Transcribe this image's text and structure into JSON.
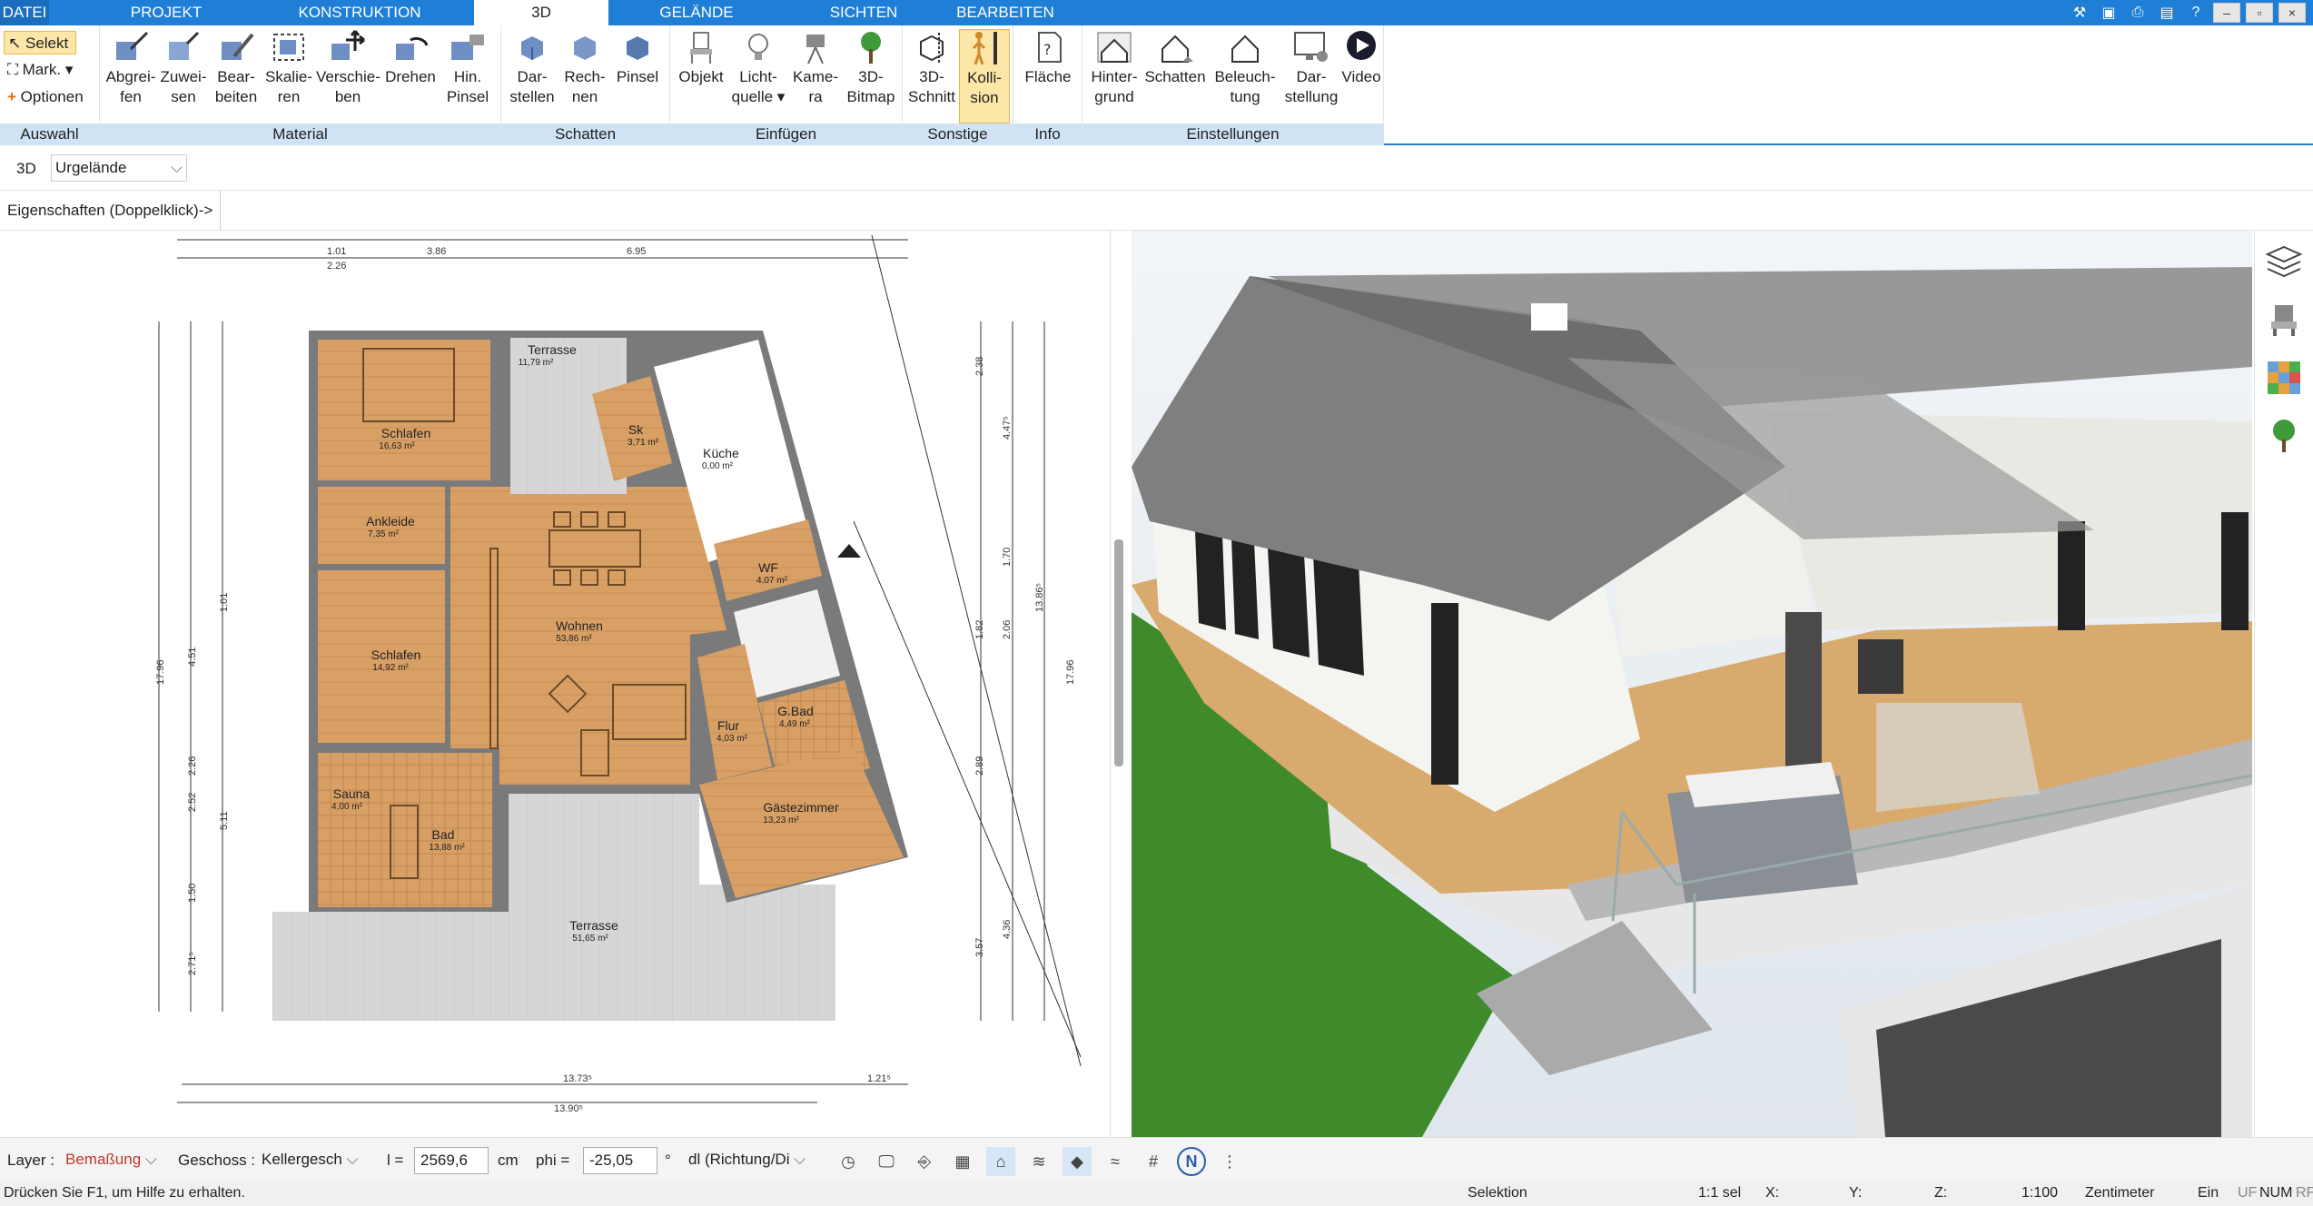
{
  "menu_tabs": [
    "DATEI",
    "PROJEKT",
    "KONSTRUKTION",
    "3D",
    "GELÄNDE",
    "SICHTEN",
    "BEARBEITEN"
  ],
  "active_tab": "3D",
  "ribbon": {
    "auswahl": {
      "selekt": "Selekt",
      "mark": "Mark.",
      "optionen": "Optionen",
      "label": "Auswahl"
    },
    "material": {
      "label": "Material",
      "buttons": [
        [
          "Abgrei-",
          "fen"
        ],
        [
          "Zuwei-",
          "sen"
        ],
        [
          "Bear-",
          "beiten"
        ],
        [
          "Skalie-",
          "ren"
        ],
        [
          "Verschie-",
          "ben"
        ],
        [
          "Drehen",
          ""
        ],
        [
          "Hin.",
          "Pinsel"
        ]
      ]
    },
    "schatten": {
      "label": "Schatten",
      "buttons": [
        [
          "Dar-",
          "stellen"
        ],
        [
          "Rech-",
          "nen"
        ],
        [
          "Pinsel",
          ""
        ]
      ]
    },
    "einfuegen": {
      "label": "Einfügen",
      "buttons": [
        [
          "Objekt",
          ""
        ],
        [
          "Licht-",
          "quelle"
        ],
        [
          "Kame-",
          "ra"
        ],
        [
          "3D-",
          "Bitmap"
        ]
      ]
    },
    "sonstige": {
      "label": "Sonstige",
      "buttons": [
        [
          "3D-",
          "Schnitt"
        ],
        [
          "Kolli-",
          "sion"
        ]
      ]
    },
    "info": {
      "label": "Info",
      "buttons": [
        [
          "Fläche",
          ""
        ]
      ]
    },
    "einstellungen": {
      "label": "Einstellungen",
      "buttons": [
        [
          "Hinter-",
          "grund"
        ],
        [
          "Schatten",
          ""
        ],
        [
          "Beleuch-",
          "tung"
        ],
        [
          "Dar-",
          "stellung"
        ],
        [
          "Video",
          ""
        ]
      ]
    }
  },
  "viewbar": {
    "mode": "3D",
    "terrain": "Urgelände"
  },
  "propbar": {
    "text": "Eigenschaften (Doppelklick)->"
  },
  "plan": {
    "dims_top": [
      "1.01",
      "3.86",
      "6.95",
      "2.26"
    ],
    "dims_bottom": [
      "13.73⁵",
      "13.90⁵",
      "1.21⁵"
    ],
    "dims_left": [
      "17.96",
      "4.51",
      "5.11",
      "1.01",
      "2.26",
      "1.50",
      "2.71⁵",
      "2.52"
    ],
    "dims_right": [
      "17.96",
      "13.86⁵",
      "2.38",
      "4.47⁵",
      "1.70",
      "2.06",
      "2.89",
      "3.57",
      "4.36",
      "1.82"
    ],
    "rooms": [
      {
        "name": "Terrasse",
        "area": "11,79 m²"
      },
      {
        "name": "Schlafen",
        "area": "16,63 m²"
      },
      {
        "name": "Sk",
        "area": "3,71 m²"
      },
      {
        "name": "Küche",
        "area": "0,00 m²"
      },
      {
        "name": "Ankleide",
        "area": "7,35 m²"
      },
      {
        "name": "WF",
        "area": "4,07 m²"
      },
      {
        "name": "Wohnen",
        "area": "53,86 m²"
      },
      {
        "name": "Schlafen",
        "area": "14,92 m²"
      },
      {
        "name": "G.Bad",
        "area": "4,49 m²"
      },
      {
        "name": "Flur",
        "area": "4,03 m²"
      },
      {
        "name": "Sauna",
        "area": "4,00 m²"
      },
      {
        "name": "Gästezimmer",
        "area": "13,23 m²"
      },
      {
        "name": "Bad",
        "area": "13,88 m²"
      },
      {
        "name": "Terrasse",
        "area": "51,65 m²"
      }
    ]
  },
  "bottombar": {
    "layer_label": "Layer :",
    "layer_value": "Bemaßung",
    "geschoss_label": "Geschoss :",
    "geschoss_value": "Kellergesch",
    "l_label": "l =",
    "l_value": "2569,6",
    "l_unit": "cm",
    "phi_label": "phi =",
    "phi_value": "-25,05",
    "phi_unit": "°",
    "dir_value": "dl (Richtung/Di"
  },
  "statusbar": {
    "help": "Drücken Sie F1, um Hilfe zu erhalten.",
    "mode": "Selektion",
    "sel": "1:1 sel",
    "x": "X:",
    "y": "Y:",
    "z": "Z:",
    "scale": "1:100",
    "unit": "Zentimeter",
    "ein": "Ein",
    "uf": "UF",
    "num": "NUM",
    "rf": "RF"
  },
  "colors": {
    "accent": "#1f7fd6",
    "ribbon_group": "#cfe3f5",
    "room_floor": "#d9a066",
    "wall": "#7a7a7a",
    "terrace": "#d8d8d8",
    "roof": "#7f7f7f",
    "grass": "#3f8a2b",
    "wood": "#d9aa6e",
    "highlight": "#fde7a8"
  }
}
